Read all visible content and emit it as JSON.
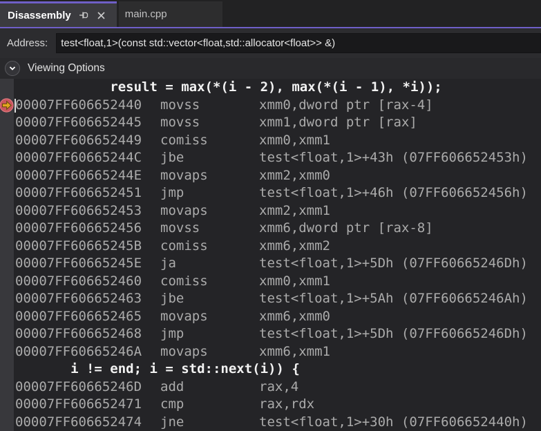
{
  "tabs": [
    {
      "label": "Disassembly",
      "active": true,
      "pinned": true
    },
    {
      "label": "main.cpp",
      "active": false
    }
  ],
  "icons": {
    "pin": "pin-icon",
    "close": "close-icon",
    "chevron": "chevron-down-icon",
    "current_statement": "yellow-arrow-icon"
  },
  "address_bar": {
    "label": "Address:",
    "value": "test<float,1>(const std::vector<float,std::allocator<float>> &)"
  },
  "viewing_options": {
    "label": "Viewing Options"
  },
  "colors": {
    "accent_purple": "#6f5fc8",
    "arrow_yellow": "#e3a51f",
    "arrow_circle_red": "#c9575e",
    "instruction_text": "#ababab",
    "source_text": "#f2f2f2"
  },
  "disassembly": {
    "rows": [
      {
        "type": "source",
        "indent": 12,
        "text": "result = max(*(i - 2), max(*(i - 1), *i));"
      },
      {
        "type": "instruction",
        "current": true,
        "address": "00007FF606652440",
        "mnemonic": "movss",
        "operands": "xmm0,dword ptr [rax-4]"
      },
      {
        "type": "instruction",
        "address": "00007FF606652445",
        "mnemonic": "movss",
        "operands": "xmm1,dword ptr [rax]"
      },
      {
        "type": "instruction",
        "address": "00007FF606652449",
        "mnemonic": "comiss",
        "operands": "xmm0,xmm1"
      },
      {
        "type": "instruction",
        "address": "00007FF60665244C",
        "mnemonic": "jbe",
        "operands": "test<float,1>+43h (07FF606652453h)"
      },
      {
        "type": "instruction",
        "address": "00007FF60665244E",
        "mnemonic": "movaps",
        "operands": "xmm2,xmm0"
      },
      {
        "type": "instruction",
        "address": "00007FF606652451",
        "mnemonic": "jmp",
        "operands": "test<float,1>+46h (07FF606652456h)"
      },
      {
        "type": "instruction",
        "address": "00007FF606652453",
        "mnemonic": "movaps",
        "operands": "xmm2,xmm1"
      },
      {
        "type": "instruction",
        "address": "00007FF606652456",
        "mnemonic": "movss",
        "operands": "xmm6,dword ptr [rax-8]"
      },
      {
        "type": "instruction",
        "address": "00007FF60665245B",
        "mnemonic": "comiss",
        "operands": "xmm6,xmm2"
      },
      {
        "type": "instruction",
        "address": "00007FF60665245E",
        "mnemonic": "ja",
        "operands": "test<float,1>+5Dh (07FF60665246Dh)"
      },
      {
        "type": "instruction",
        "address": "00007FF606652460",
        "mnemonic": "comiss",
        "operands": "xmm0,xmm1"
      },
      {
        "type": "instruction",
        "address": "00007FF606652463",
        "mnemonic": "jbe",
        "operands": "test<float,1>+5Ah (07FF60665246Ah)"
      },
      {
        "type": "instruction",
        "address": "00007FF606652465",
        "mnemonic": "movaps",
        "operands": "xmm6,xmm0"
      },
      {
        "type": "instruction",
        "address": "00007FF606652468",
        "mnemonic": "jmp",
        "operands": "test<float,1>+5Dh (07FF60665246Dh)"
      },
      {
        "type": "instruction",
        "address": "00007FF60665246A",
        "mnemonic": "movaps",
        "operands": "xmm6,xmm1"
      },
      {
        "type": "source",
        "indent": 7,
        "text": "i != end; i = std::next(i)) {"
      },
      {
        "type": "instruction",
        "address": "00007FF60665246D",
        "mnemonic": "add",
        "operands": "rax,4"
      },
      {
        "type": "instruction",
        "address": "00007FF606652471",
        "mnemonic": "cmp",
        "operands": "rax,rdx"
      },
      {
        "type": "instruction",
        "address": "00007FF606652474",
        "mnemonic": "jne",
        "operands": "test<float,1>+30h (07FF606652440h)"
      }
    ]
  }
}
